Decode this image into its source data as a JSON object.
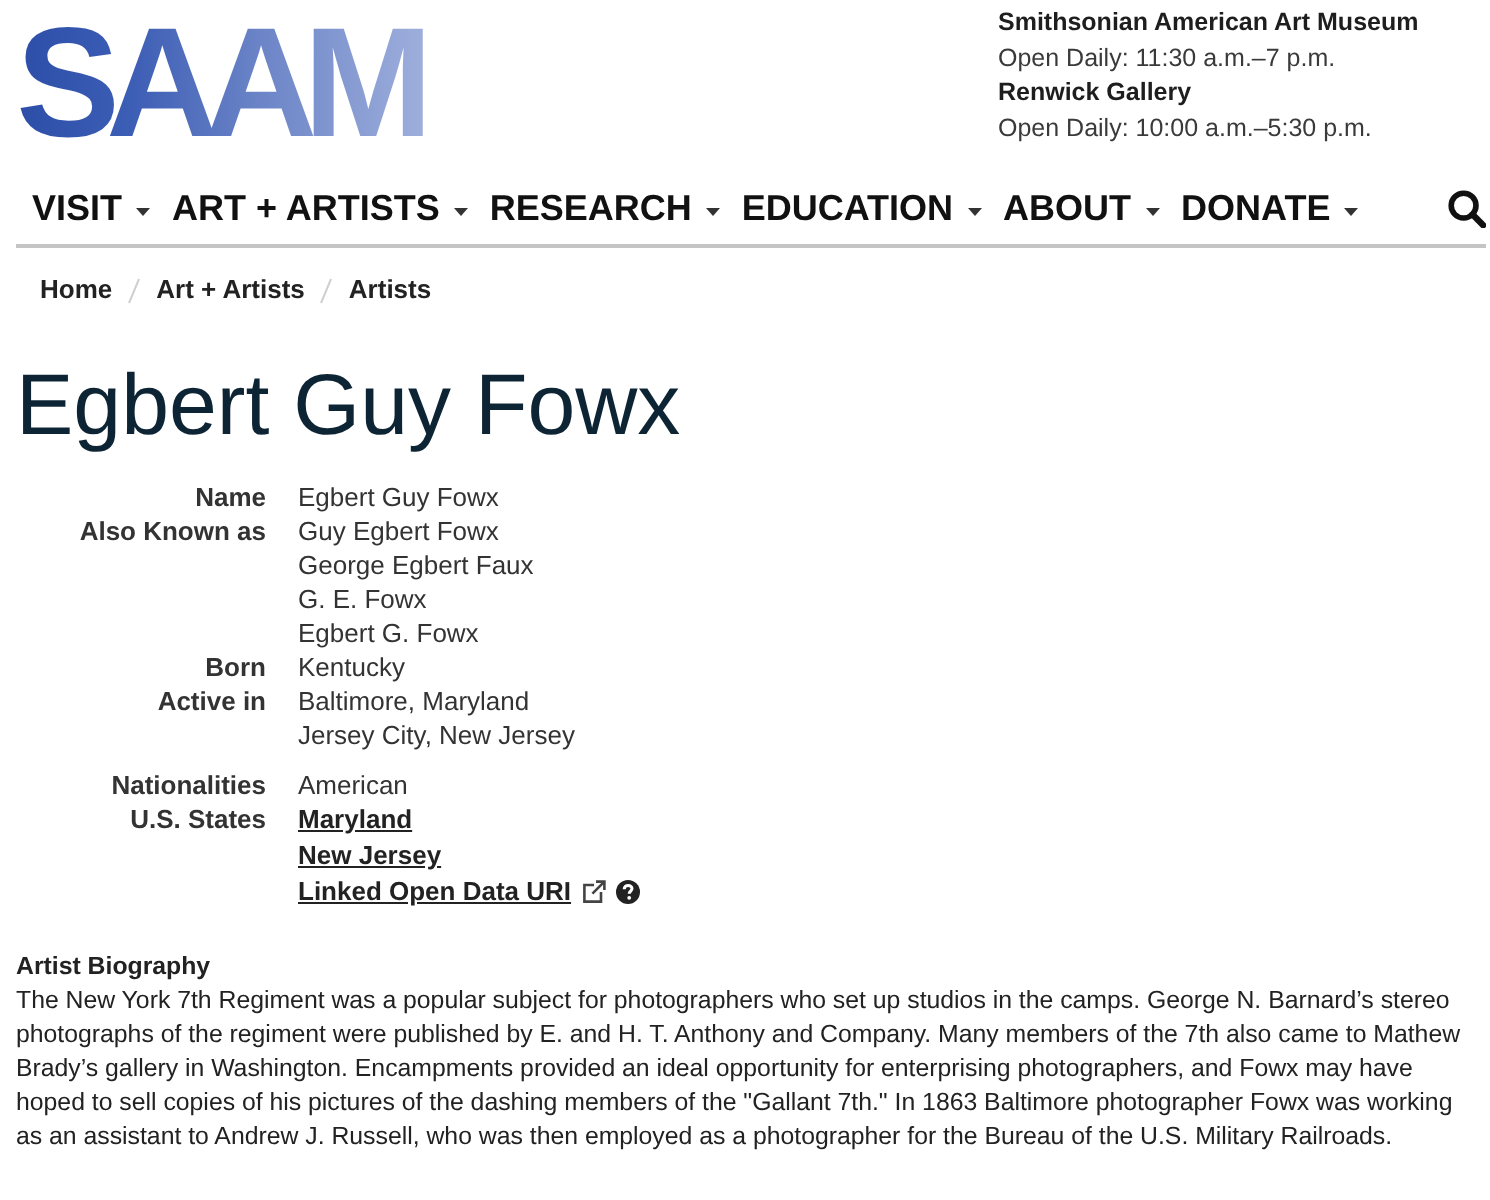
{
  "logo": {
    "text": "SAAM"
  },
  "locations": [
    {
      "name": "Smithsonian American Art Museum",
      "hours": "Open Daily: 11:30 a.m.–7 p.m."
    },
    {
      "name": "Renwick Gallery",
      "hours": "Open Daily: 10:00 a.m.–5:30 p.m."
    }
  ],
  "nav": {
    "items": [
      {
        "label": "VISIT"
      },
      {
        "label": "ART + ARTISTS"
      },
      {
        "label": "RESEARCH"
      },
      {
        "label": "EDUCATION"
      },
      {
        "label": "ABOUT"
      },
      {
        "label": "DONATE"
      }
    ]
  },
  "breadcrumb": [
    {
      "label": "Home"
    },
    {
      "label": "Art + Artists"
    },
    {
      "label": "Artists"
    }
  ],
  "title": "Egbert Guy Fowx",
  "details": [
    {
      "rows": [
        {
          "label": "Name",
          "values": [
            {
              "kind": "text",
              "text": "Egbert Guy Fowx"
            }
          ]
        },
        {
          "label": "Also Known as",
          "values": [
            {
              "kind": "text",
              "text": "Guy Egbert Fowx"
            },
            {
              "kind": "text",
              "text": "George Egbert Faux"
            },
            {
              "kind": "text",
              "text": "G. E. Fowx"
            },
            {
              "kind": "text",
              "text": "Egbert G. Fowx"
            }
          ]
        },
        {
          "label": "Born",
          "values": [
            {
              "kind": "text",
              "text": "Kentucky"
            }
          ]
        },
        {
          "label": "Active in",
          "values": [
            {
              "kind": "text",
              "text": "Baltimore, Maryland"
            },
            {
              "kind": "text",
              "text": "Jersey City, New Jersey"
            }
          ]
        }
      ]
    },
    {
      "rows": [
        {
          "label": "Nationalities",
          "values": [
            {
              "kind": "text",
              "text": "American"
            }
          ]
        },
        {
          "label": "U.S. States",
          "values": [
            {
              "kind": "link",
              "text": "Maryland"
            },
            {
              "kind": "link",
              "text": "New Jersey"
            },
            {
              "kind": "external",
              "text": "Linked Open Data URI"
            }
          ]
        }
      ]
    }
  ],
  "biography": {
    "heading": "Artist Biography",
    "text": "The New York 7th Regiment was a popular subject for photographers who set up studios in the camps. George N. Barnard’s stereo photographs of the regiment were published by E. and H. T. Anthony and Company. Many members of the 7th also came to Mathew Brady’s gallery in Washington. Encampments provided an ideal opportunity for enterprising photographers, and Fowx may have hoped to sell copies of his pictures of the dashing members of the \"Gallant 7th.\" In 1863 Baltimore photographer Fowx was working as an assistant to Andrew J. Russell, who was then employed as a photographer for the Bureau of the U.S. Military Railroads."
  }
}
